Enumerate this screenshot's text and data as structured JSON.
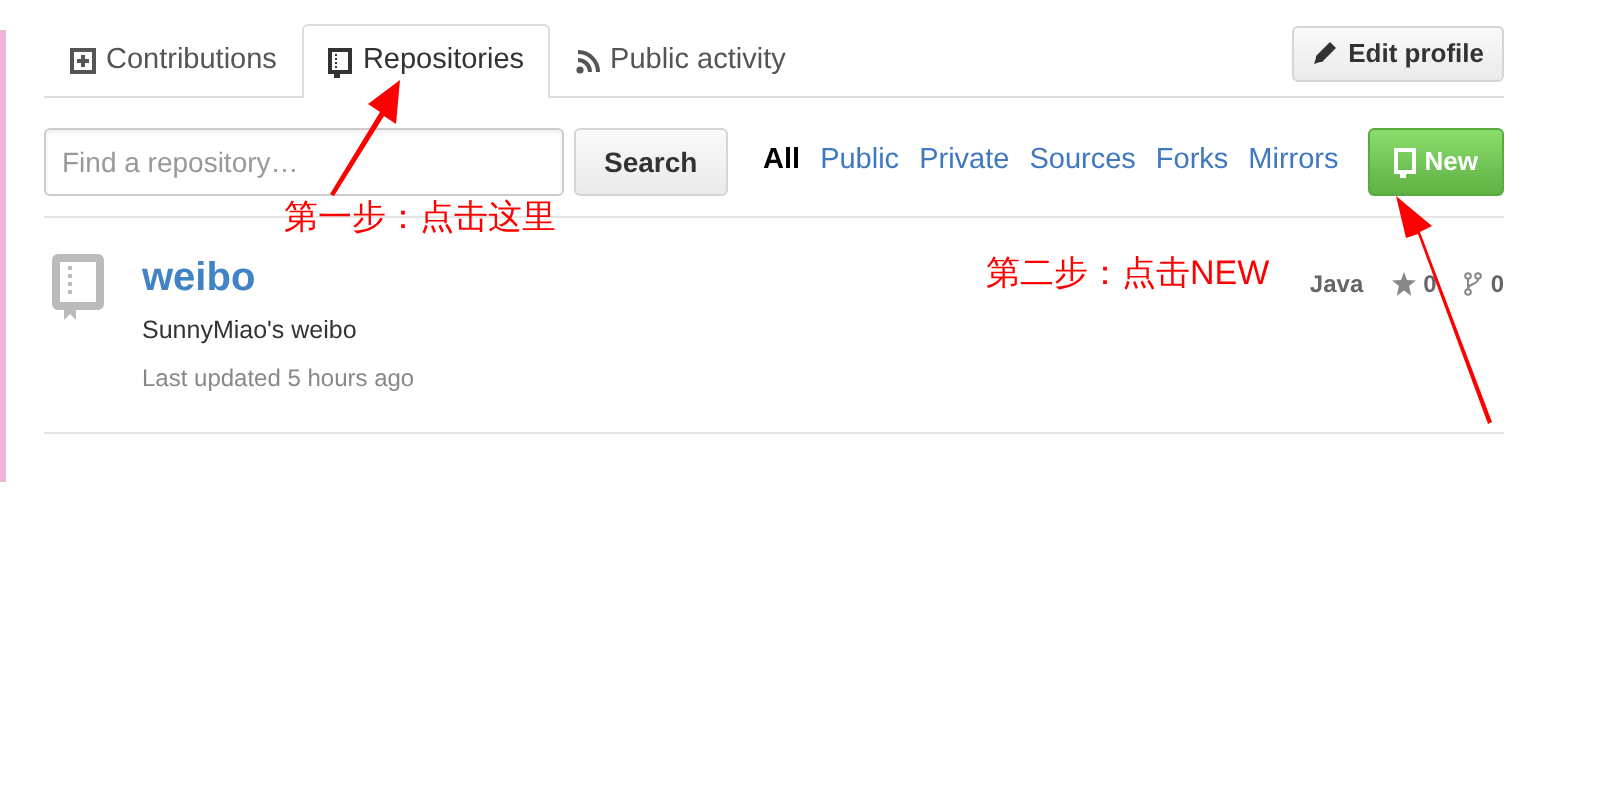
{
  "tabs": [
    {
      "label": "Contributions",
      "kind": "contributions",
      "selected": false
    },
    {
      "label": "Repositories",
      "kind": "repositories",
      "selected": true
    },
    {
      "label": "Public activity",
      "kind": "activity",
      "selected": false
    }
  ],
  "edit_profile_button": "Edit profile",
  "search": {
    "placeholder": "Find a repository…",
    "button": "Search"
  },
  "filters": [
    {
      "label": "All",
      "selected": true
    },
    {
      "label": "Public",
      "selected": false
    },
    {
      "label": "Private",
      "selected": false
    },
    {
      "label": "Sources",
      "selected": false
    },
    {
      "label": "Forks",
      "selected": false
    },
    {
      "label": "Mirrors",
      "selected": false
    }
  ],
  "new_button": "New",
  "repositories": [
    {
      "name": "weibo",
      "description": "SunnyMiao's weibo",
      "updated": "Last updated 5 hours ago",
      "language": "Java",
      "stars": "0",
      "forks": "0"
    }
  ],
  "annotations": [
    {
      "text": "第一步：点击这里"
    },
    {
      "text": "第二步：点击NEW"
    }
  ]
}
